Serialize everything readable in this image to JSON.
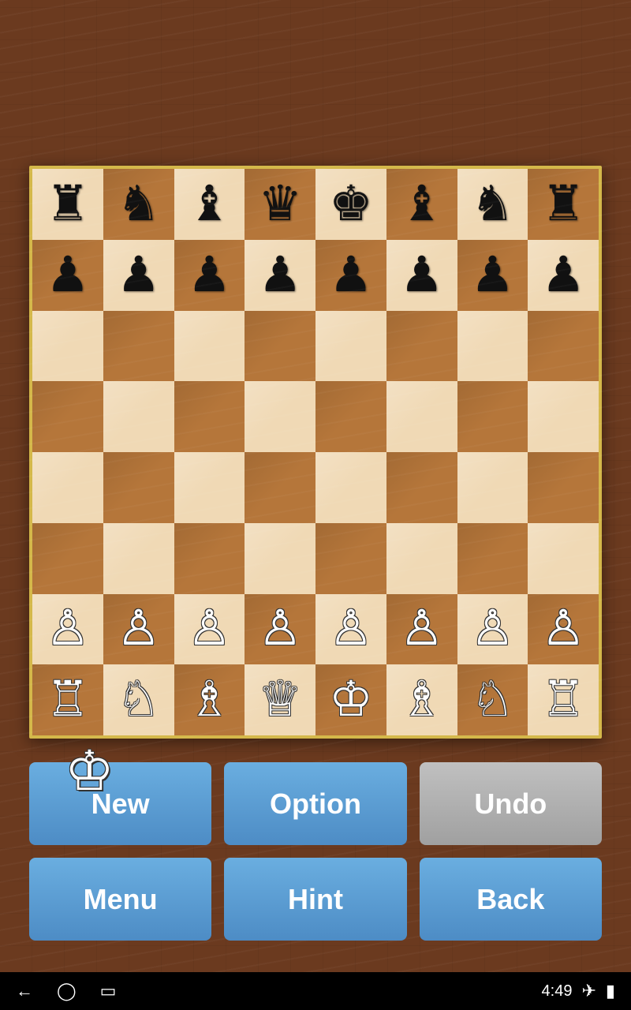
{
  "board": {
    "rows": [
      [
        "br",
        "bn",
        "bb",
        "bq",
        "bk",
        "bb",
        "bn",
        "br"
      ],
      [
        "bp",
        "bp",
        "bp",
        "bp",
        "bp",
        "bp",
        "bp",
        "bp"
      ],
      [
        null,
        null,
        null,
        null,
        null,
        null,
        null,
        null
      ],
      [
        null,
        null,
        null,
        null,
        null,
        null,
        null,
        null
      ],
      [
        null,
        null,
        null,
        null,
        null,
        null,
        null,
        null
      ],
      [
        null,
        null,
        null,
        null,
        null,
        null,
        null,
        null
      ],
      [
        "wp",
        "wp",
        "wp",
        "wp",
        "wp",
        "wp",
        "wp",
        "wp"
      ],
      [
        "wr",
        "wn",
        "wb",
        "wq",
        "wk",
        "wb",
        "wn",
        "wr"
      ]
    ]
  },
  "buttons": {
    "new_label": "New",
    "option_label": "Option",
    "undo_label": "Undo",
    "menu_label": "Menu",
    "hint_label": "Hint",
    "back_label": "Back"
  },
  "status_bar": {
    "time": "4:49",
    "icons": [
      "back-icon",
      "home-icon",
      "recents-icon",
      "plane-icon",
      "battery-icon"
    ]
  },
  "current_player_icon": "♔"
}
